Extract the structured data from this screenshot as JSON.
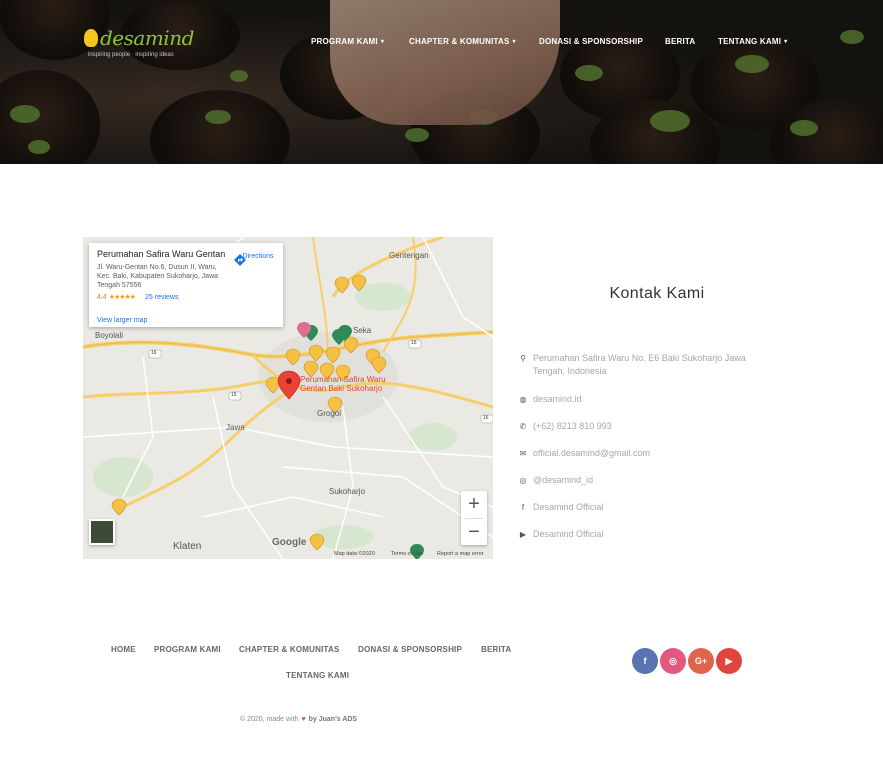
{
  "brand": {
    "name": "desamind",
    "tagline": "inspiring people · inspiring ideas"
  },
  "nav": {
    "items": [
      {
        "label": "PROGRAM KAMI",
        "dropdown": true
      },
      {
        "label": "CHAPTER & KOMUNITAS",
        "dropdown": true
      },
      {
        "label": "DONASI & SPONSORSHIP",
        "dropdown": false
      },
      {
        "label": "BERITA",
        "dropdown": false
      },
      {
        "label": "TENTANG KAMI",
        "dropdown": true
      }
    ],
    "caret": "▾"
  },
  "map": {
    "card": {
      "title": "Perumahan Safira Waru Gentan",
      "address": "Jl. Waru-Gentan No.6, Dusun II, Waru, Kec. Baki, Kabupaten Sukoharjo, Jawa Tengah 57556",
      "rating": "4.4",
      "stars": "★★★★★",
      "reviews": "25 reviews",
      "link": "View larger map",
      "directions": "Directions"
    },
    "marker_label": "Perumahan Safira Waru Gentan Baki Sukoharjo",
    "places": {
      "gentengan": "Gentengan",
      "boyolali": "Boyolali",
      "jawa": "Jawa",
      "grogol": "Grogol",
      "sukoharjo": "Sukoharjo",
      "klaten": "Klaten",
      "sekar": "Seka"
    },
    "roads": [
      "16",
      "15",
      "15",
      "16"
    ],
    "zoom_in": "+",
    "zoom_out": "−",
    "google": "Google",
    "footer": [
      "Map data ©2020",
      "Terms of Use",
      "Report a map error"
    ],
    "colors": {
      "marker": "#ea4335",
      "poi": "#f6c142",
      "poi_green": "#2e8b57",
      "road": "#f6cf6a"
    }
  },
  "contact": {
    "title": "Kontak Kami",
    "items": [
      {
        "icon": "location-icon",
        "glyph": "⚲",
        "text": "Perumahan Safira Waru No. E6 Baki Sukoharjo Jawa Tengah, Indonesia"
      },
      {
        "icon": "globe-icon",
        "glyph": "◍",
        "text": "desamind.id"
      },
      {
        "icon": "whatsapp-icon",
        "glyph": "✆",
        "text": "(+62) 8213 810 993"
      },
      {
        "icon": "mail-icon",
        "glyph": "✉",
        "text": "official.desamind@gmail.com"
      },
      {
        "icon": "instagram-icon",
        "glyph": "◎",
        "text": "@desamind_id"
      },
      {
        "icon": "facebook-icon",
        "glyph": "f",
        "text": "Desamind Official"
      },
      {
        "icon": "youtube-icon",
        "glyph": "▶",
        "text": "Desamind Official"
      }
    ]
  },
  "footer": {
    "nav": [
      "HOME",
      "PROGRAM KAMI",
      "CHAPTER & KOMUNITAS",
      "DONASI & SPONSORSHIP",
      "BERITA",
      "TENTANG KAMI"
    ],
    "social": [
      {
        "name": "facebook",
        "glyph": "f",
        "color": "#5b73b0"
      },
      {
        "name": "instagram",
        "glyph": "◎",
        "color": "#e4577f"
      },
      {
        "name": "google-plus",
        "glyph": "G+",
        "color": "#e0634b"
      },
      {
        "name": "youtube",
        "glyph": "▶",
        "color": "#e0443b"
      }
    ],
    "copyright_pre": "© 2020, made with",
    "heart": "♥",
    "copyright_by": "by Juan's ADS"
  }
}
